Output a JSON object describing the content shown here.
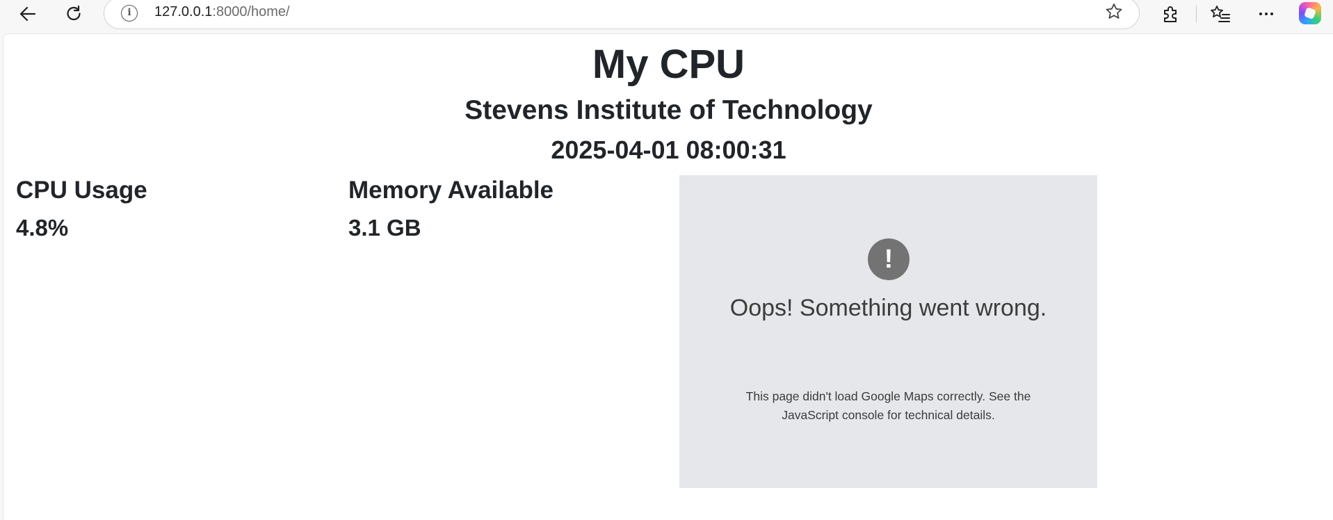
{
  "browser": {
    "url_host": "127.0.0.1",
    "url_rest": ":8000/home/",
    "icons": {
      "back": "back-arrow-icon",
      "reload": "reload-icon",
      "site_info": "info-icon",
      "favorite": "star-icon",
      "extensions": "puzzle-icon",
      "favorites": "favorites-icon",
      "more": "more-icon",
      "copilot": "copilot-icon"
    }
  },
  "page": {
    "title": "My CPU",
    "subtitle": "Stevens Institute of Technology",
    "timestamp": "2025-04-01 08:00:31"
  },
  "stats": {
    "cpu": {
      "label": "CPU Usage",
      "value": "4.8%"
    },
    "memory": {
      "label": "Memory Available",
      "value": "3.1 GB"
    }
  },
  "map_error": {
    "icon": "!",
    "title": "Oops! Something went wrong.",
    "detail": "This page didn't load Google Maps correctly. See the JavaScript console for technical details."
  },
  "colors": {
    "text": "#212529",
    "panel_bg": "#e5e7ea",
    "error_icon_bg": "#737373"
  }
}
